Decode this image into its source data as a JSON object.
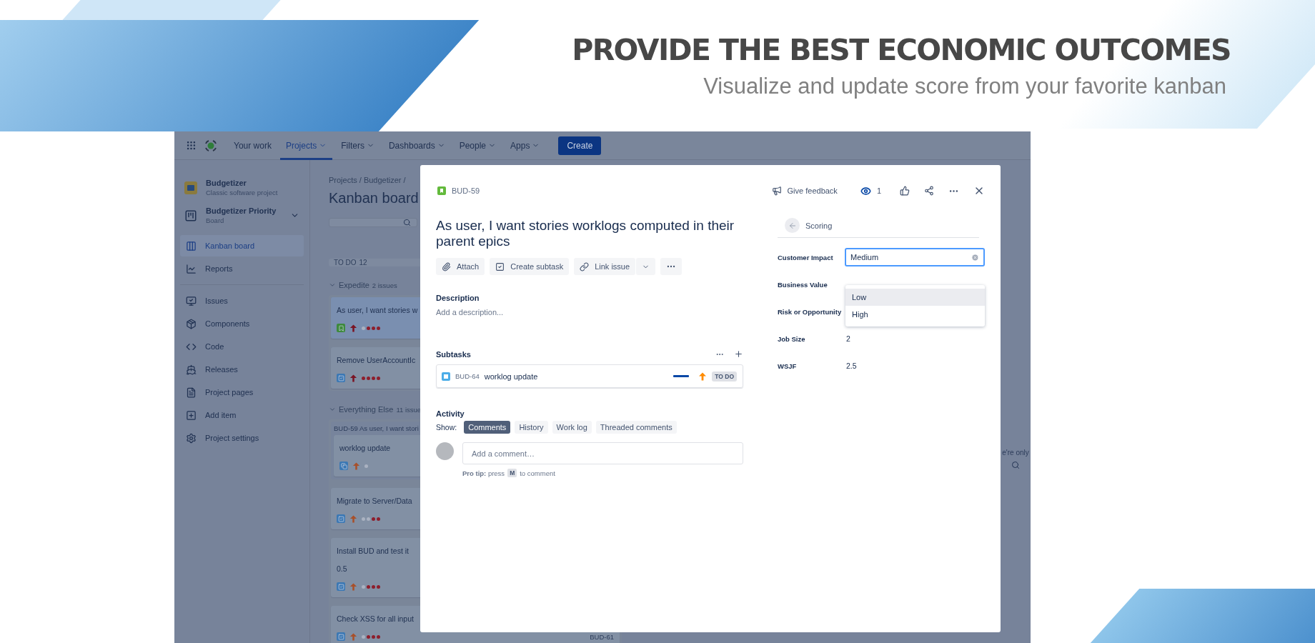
{
  "banner": {
    "headline": "PROVIDE THE BEST ECONOMIC OUTCOMES",
    "subheadline": "Visualize and update score from your favorite kanban"
  },
  "nav": {
    "items": [
      {
        "label": "Your work",
        "selected": false,
        "dropdown": false
      },
      {
        "label": "Projects",
        "selected": true,
        "dropdown": true
      },
      {
        "label": "Filters",
        "selected": false,
        "dropdown": true
      },
      {
        "label": "Dashboards",
        "selected": false,
        "dropdown": true
      },
      {
        "label": "People",
        "selected": false,
        "dropdown": true
      },
      {
        "label": "Apps",
        "selected": false,
        "dropdown": true
      }
    ],
    "create_button": "Create"
  },
  "sidebar": {
    "project": {
      "name": "Budgetizer",
      "type": "Classic software project"
    },
    "board": {
      "name": "Budgetizer Priority",
      "type": "Board"
    },
    "groups": [
      {
        "items": [
          {
            "label": "Kanban board",
            "selected": true
          },
          {
            "label": "Reports",
            "selected": false
          }
        ]
      },
      {
        "items": [
          {
            "label": "Issues",
            "selected": false
          },
          {
            "label": "Components",
            "selected": false
          },
          {
            "label": "Code",
            "selected": false
          },
          {
            "label": "Releases",
            "selected": false
          },
          {
            "label": "Project pages",
            "selected": false
          },
          {
            "label": "Add item",
            "selected": false
          },
          {
            "label": "Project settings",
            "selected": false
          }
        ]
      }
    ]
  },
  "board": {
    "breadcrumb": "Projects / Budgetizer /",
    "title": "Kanban board",
    "column": {
      "name": "TO DO",
      "count": "12"
    },
    "swimlanes": [
      {
        "name": "Expedite",
        "count": "2 issues",
        "cards": [
          {
            "title": "As user, I want stories w",
            "kind": "story",
            "color": "#7a1424",
            "stars": 3,
            "selected": true
          },
          {
            "title": "Remove UserAccountIc",
            "kind": "task",
            "color": "#7a1424",
            "stars": 4,
            "selected": false
          }
        ]
      },
      {
        "name": "Everything Else",
        "count": "11 issue",
        "cards": [
          {
            "title": "worklog update",
            "kind": "subtask",
            "color": "#a8502a",
            "selected": false,
            "parent": {
              "key": "BUD-59",
              "title": "As user, I want stori"
            }
          },
          {
            "title": "Migrate to Server/Data",
            "kind": "task",
            "color": "#a8502a",
            "stars": 2,
            "selected": false
          },
          {
            "title": "Install BUD and test it",
            "kind": "task",
            "color": "#a8502a",
            "stars": 3,
            "selected": false,
            "estimate": "0.5"
          },
          {
            "title": "Check XSS for all input",
            "kind": "task",
            "color": "#a8502a",
            "stars": 3,
            "selected": false,
            "key": "BUD-61"
          }
        ]
      }
    ],
    "side_note": "e're only"
  },
  "modal": {
    "issue_key": "BUD-59",
    "feedback": "Give feedback",
    "watchers": "1",
    "title": "As user, I want stories worklogs computed in their parent epics",
    "actions": [
      "Attach",
      "Create subtask",
      "Link issue"
    ],
    "description": {
      "heading": "Description",
      "placeholder": "Add a description..."
    },
    "subtasks": {
      "heading": "Subtasks",
      "items": [
        {
          "key": "BUD-64",
          "title": "worklog update",
          "color": "#ff8b00",
          "status": "TO DO"
        }
      ]
    },
    "activity": {
      "heading": "Activity",
      "show_label": "Show:",
      "filters": [
        {
          "label": "Comments",
          "selected": true
        },
        {
          "label": "History",
          "selected": false
        },
        {
          "label": "Work log",
          "selected": false
        },
        {
          "label": "Threaded comments",
          "selected": false
        }
      ],
      "comment_placeholder": "Add a comment…",
      "pro_tip": "**Pro tip:** press",
      "pro_tip_key": "M",
      "pro_tip_after": "to comment"
    },
    "scoring": {
      "title": "Scoring",
      "fields": [
        {
          "label": "Customer Impact",
          "value": "Medium",
          "kind": "select"
        },
        {
          "label": "Business Value",
          "kind": "hidden"
        },
        {
          "label": "Risk or Opportunity",
          "kind": "hidden"
        },
        {
          "label": "Job Size",
          "value": "2",
          "kind": "text"
        },
        {
          "label": "WSJF",
          "value": "2.5",
          "kind": "text"
        }
      ],
      "options": [
        {
          "label": "Low",
          "selected": true
        },
        {
          "label": "High",
          "selected": false
        }
      ]
    }
  }
}
